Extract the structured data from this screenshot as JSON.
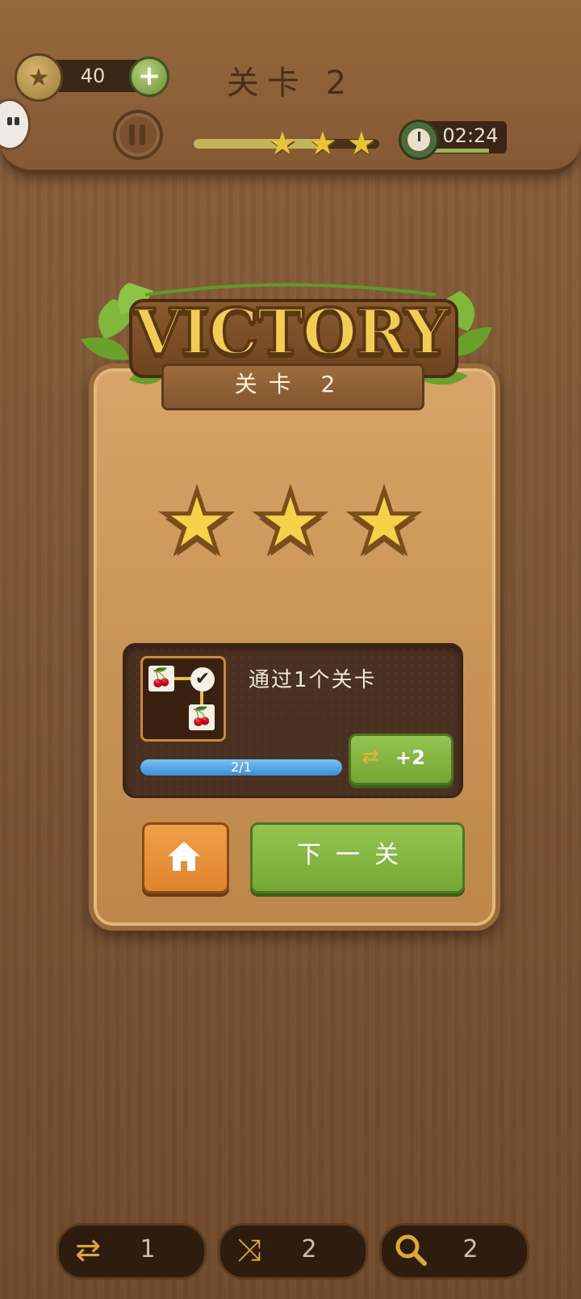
{
  "header": {
    "coins": "40",
    "level_title": "关卡 2",
    "timer": "02:24",
    "progress_fraction": 0.72,
    "stars_earned": 3
  },
  "victory": {
    "title": "VICTORY",
    "subtitle": "关卡 2",
    "stars": 3
  },
  "task": {
    "description": "通过1个关卡",
    "progress_text": "2/1",
    "progress_fraction": 1.0,
    "reward_label": "+2"
  },
  "buttons": {
    "next_label": "下一关"
  },
  "tools": [
    {
      "icon": "swap-image-icon",
      "count": "1"
    },
    {
      "icon": "shuffle-icon",
      "count": "2"
    },
    {
      "icon": "search-icon",
      "count": "2"
    }
  ],
  "colors": {
    "wood": "#7a5432",
    "star": "#f6d14a",
    "green_button": "#85b543",
    "orange_button": "#e8923a",
    "progress_blue": "#3b8ed6"
  }
}
